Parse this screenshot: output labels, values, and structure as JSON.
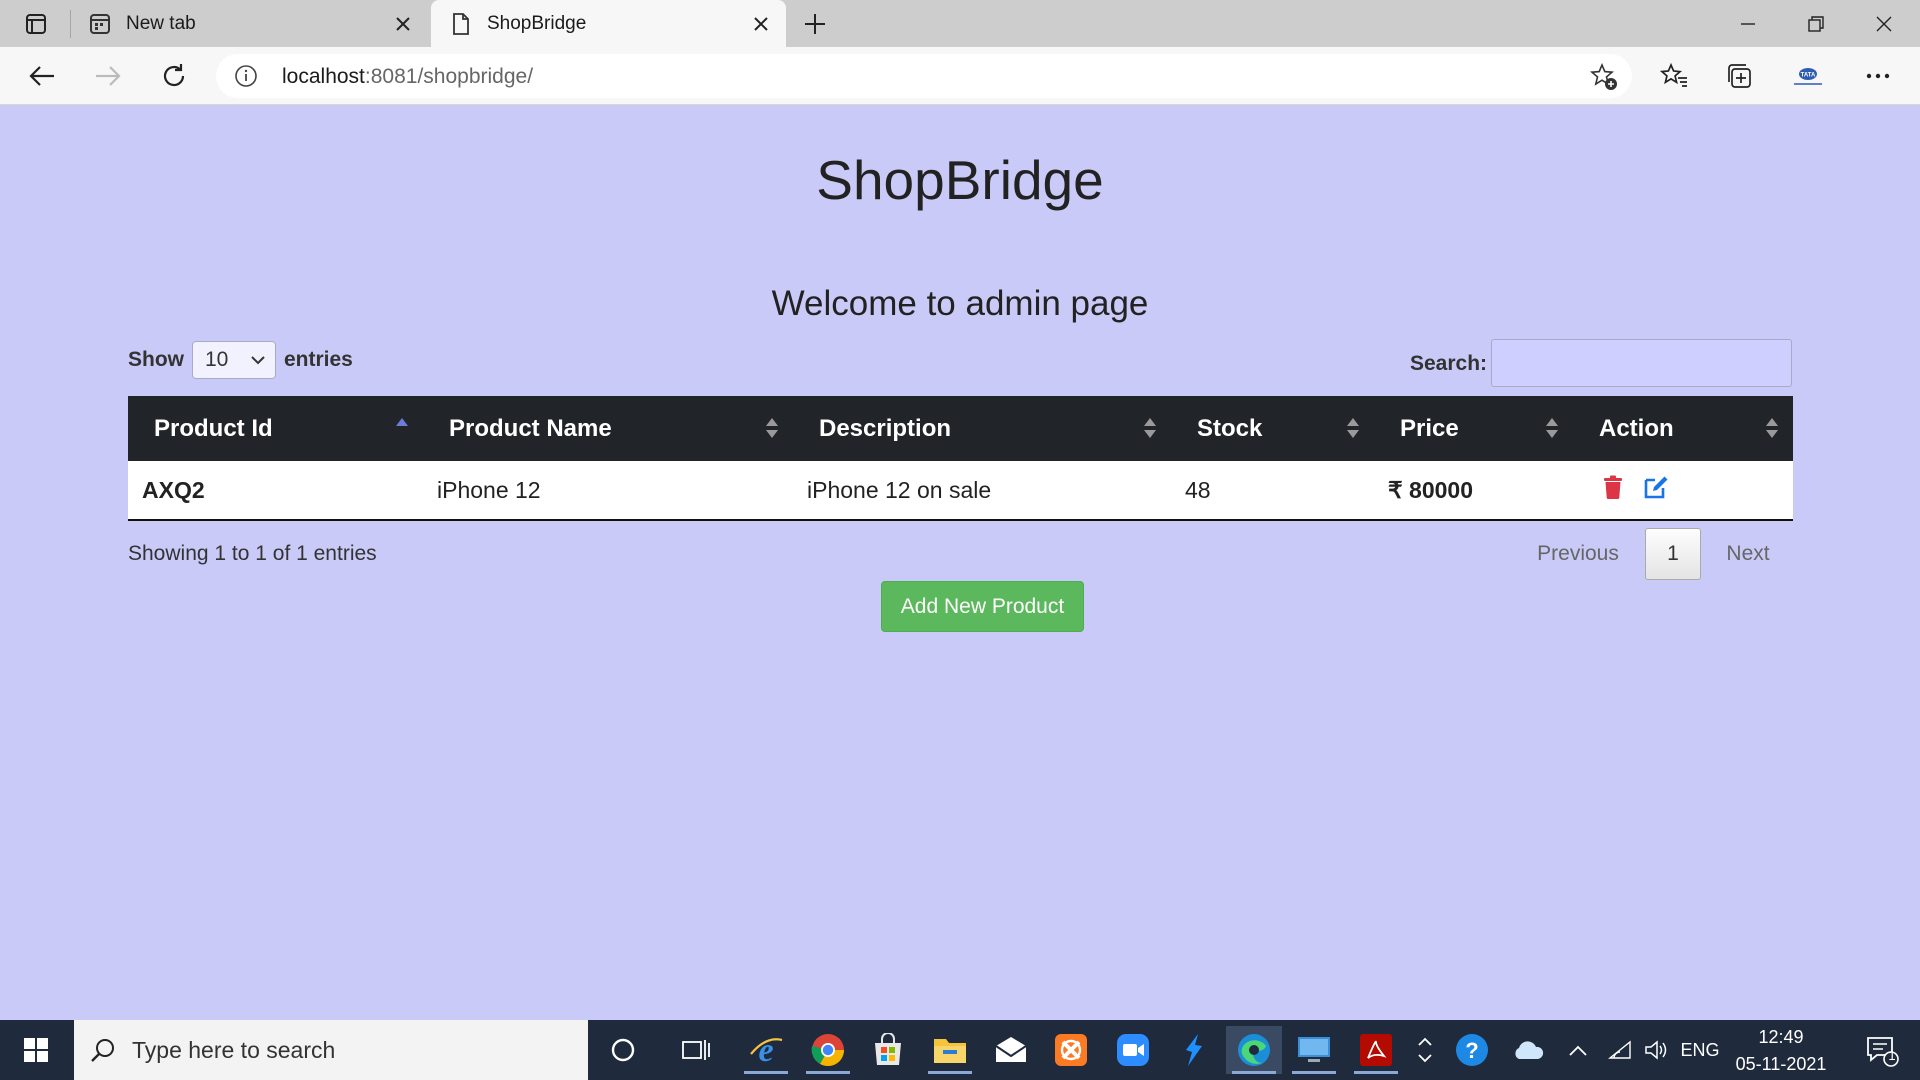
{
  "browser": {
    "tabs": [
      {
        "title": "New tab",
        "active": false
      },
      {
        "title": "ShopBridge",
        "active": true
      }
    ],
    "url_host": "localhost",
    "url_rest": ":8081/shopbridge/"
  },
  "page": {
    "title": "ShopBridge",
    "welcome": "Welcome to admin page",
    "show_label": "Show",
    "entries_value": "10",
    "entries_label": "entries",
    "search_label": "Search:",
    "search_value": "",
    "columns": [
      "Product Id",
      "Product Name",
      "Description",
      "Stock",
      "Price",
      "Action"
    ],
    "rows": [
      {
        "id": "AXQ2",
        "name": "iPhone 12",
        "description": "iPhone 12 on sale",
        "stock": "48",
        "price": "₹ 80000"
      }
    ],
    "info": "Showing 1 to 1 of 1 entries",
    "pagination": {
      "previous": "Previous",
      "current": "1",
      "next": "Next"
    },
    "add_button": "Add New Product"
  },
  "colors": {
    "page_bg": "#cacaf9",
    "table_head": "#212529",
    "add_button": "#5cb85c",
    "delete_icon": "#dc3545",
    "edit_icon": "#1a73e8"
  },
  "taskbar": {
    "search_placeholder": "Type here to search",
    "language": "ENG",
    "time": "12:49",
    "date": "05-11-2021",
    "notification_count": "1"
  }
}
